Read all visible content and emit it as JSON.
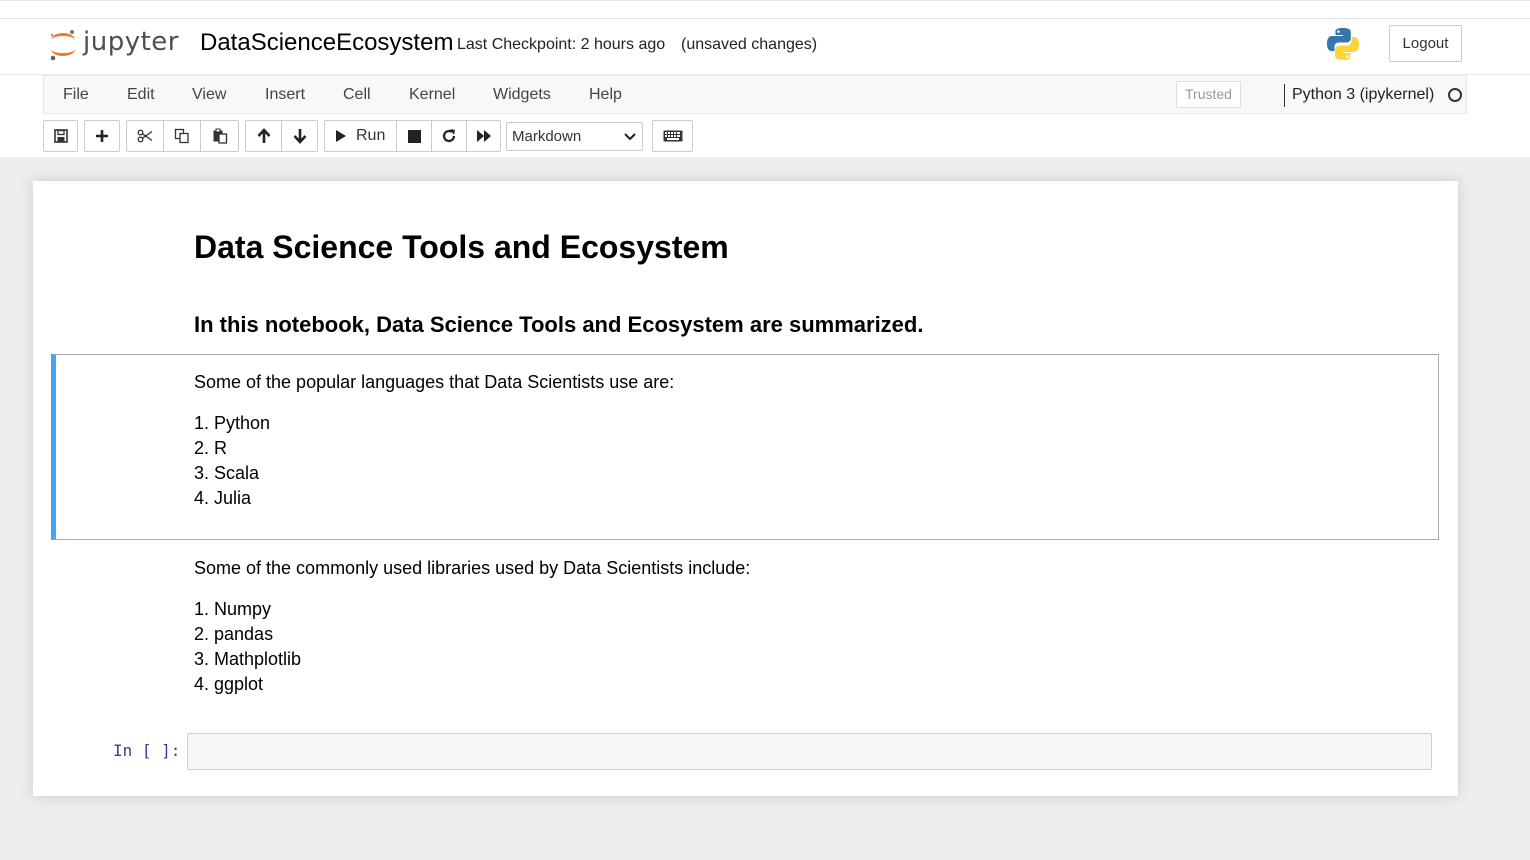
{
  "header": {
    "logo_text": "jupyter",
    "notebook_title": "DataScienceEcosystem",
    "checkpoint": "Last Checkpoint: 2 hours ago",
    "unsaved": "(unsaved changes)",
    "logout_label": "Logout"
  },
  "menubar": {
    "items": [
      "File",
      "Edit",
      "View",
      "Insert",
      "Cell",
      "Kernel",
      "Widgets",
      "Help"
    ],
    "trusted_label": "Trusted",
    "kernel_name": "Python 3 (ipykernel)"
  },
  "toolbar": {
    "run_label": "Run",
    "cell_type": "Markdown",
    "icons": [
      "save-icon",
      "plus-icon",
      "cut-icon",
      "copy-icon",
      "paste-icon",
      "arrow-up-icon",
      "arrow-down-icon",
      "play-icon",
      "stop-icon",
      "restart-icon",
      "fast-forward-icon",
      "keyboard-icon"
    ]
  },
  "notebook": {
    "h1": "Data Science Tools and Ecosystem",
    "h2": "In this notebook, Data Science Tools and Ecosystem are summarized.",
    "languages_intro": "Some of the popular languages that Data Scientists use are:",
    "languages": [
      "Python",
      "R",
      "Scala",
      "Julia"
    ],
    "libraries_intro": "Some of the commonly used libraries used by Data Scientists include:",
    "libraries": [
      "Numpy",
      "pandas",
      "Mathplotlib",
      "ggplot"
    ],
    "prompt": "In [ ]:"
  },
  "colors": {
    "selected_cell_accent": "#42a5f5",
    "prompt": "#303f9f",
    "logo_orange": "#f37726"
  }
}
